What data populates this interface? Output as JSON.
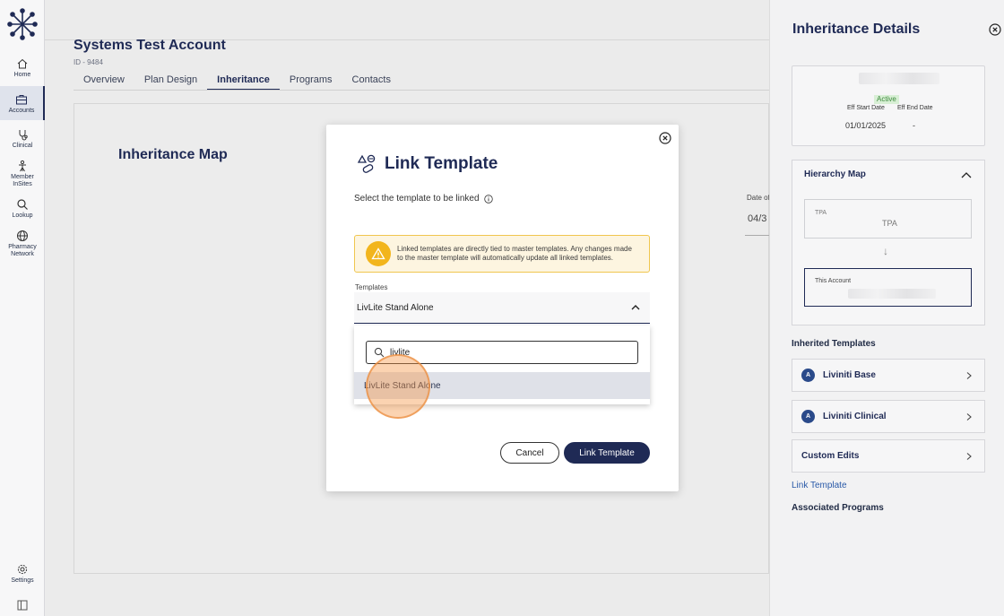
{
  "nav": {
    "items": [
      {
        "label": "Home",
        "icon": "home-icon"
      },
      {
        "label": "Accounts",
        "icon": "briefcase-icon"
      },
      {
        "label": "Clinical",
        "icon": "stethoscope-icon"
      },
      {
        "label": "Member InSites",
        "icon": "person-icon"
      },
      {
        "label": "Lookup",
        "icon": "search-icon"
      },
      {
        "label": "Pharmacy Network",
        "icon": "globe-icon"
      }
    ],
    "settings_label": "Settings",
    "active": "Accounts"
  },
  "account": {
    "title": "Systems Test Account",
    "id": "ID - 9484",
    "tabs": [
      "Overview",
      "Plan Design",
      "Inheritance",
      "Programs",
      "Contacts"
    ],
    "active_tab": "Inheritance"
  },
  "main": {
    "map_title": "Inheritance Map",
    "date_label": "Date of",
    "date_value": "04/3"
  },
  "panel": {
    "title": "Inheritance Details",
    "status": "Active",
    "eff_start_label": "Eff Start Date",
    "eff_end_label": "Eff End Date",
    "eff_start_value": "01/01/2025",
    "eff_end_value": "-",
    "hierarchy_title": "Hierarchy Map",
    "tpa_small": "TPA",
    "tpa_center": "TPA",
    "arrow": "↓",
    "this_account_label": "This Account",
    "inherited_title": "Inherited Templates",
    "templates": [
      {
        "badge": "A",
        "name": "Liviniti Base"
      },
      {
        "badge": "A",
        "name": "Liviniti Clinical"
      }
    ],
    "custom_edits": "Custom Edits",
    "link_template": "Link Template",
    "associated_title": "Associated Programs"
  },
  "modal": {
    "title": "Link Template",
    "subtitle": "Select the template to be linked",
    "warning": "Linked templates are directly tied to master templates. Any changes made to the master template will automatically update all linked templates.",
    "field_label": "Templates",
    "selected_value": "LivLite Stand Alone",
    "search_value": "livlite",
    "options": [
      "LivLite Stand Alone"
    ],
    "cancel_label": "Cancel",
    "confirm_label": "Link Template"
  },
  "colors": {
    "brand": "#1f2a55",
    "warning_bg": "#fdf5e0",
    "warning_icon": "#f2b51c",
    "status_green": "#3d8a3d",
    "highlight": "#dfe1e8"
  }
}
